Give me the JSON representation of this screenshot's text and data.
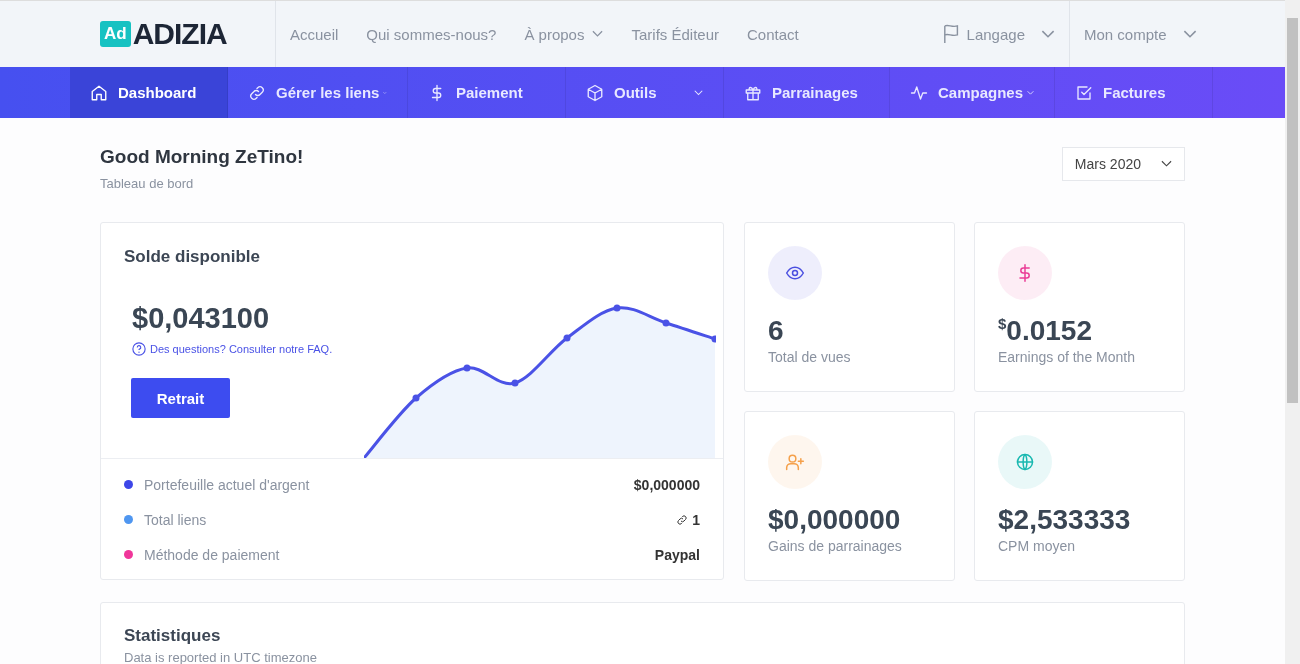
{
  "header": {
    "logo": {
      "badge": "Ad",
      "name": "ADIZIA"
    },
    "links": [
      {
        "label": "Accueil",
        "dropdown": false
      },
      {
        "label": "Qui sommes-nous?",
        "dropdown": false
      },
      {
        "label": "À propos",
        "dropdown": true
      },
      {
        "label": "Tarifs Éditeur",
        "dropdown": false
      },
      {
        "label": "Contact",
        "dropdown": false
      }
    ],
    "language": "Langage",
    "account": "Mon compte"
  },
  "nav": [
    {
      "label": "Dashboard",
      "selected": true,
      "dropdown": false
    },
    {
      "label": "Gérer les liens",
      "selected": false,
      "dropdown": true
    },
    {
      "label": "Paiement",
      "selected": false,
      "dropdown": false
    },
    {
      "label": "Outils",
      "selected": false,
      "dropdown": true
    },
    {
      "label": "Parrainages",
      "selected": false,
      "dropdown": false
    },
    {
      "label": "Campagnes",
      "selected": false,
      "dropdown": true
    },
    {
      "label": "Factures",
      "selected": false,
      "dropdown": false
    }
  ],
  "greeting": {
    "title": "Good Morning ZeTino!",
    "subtitle": "Tableau de bord"
  },
  "period": "Mars 2020",
  "balance": {
    "title": "Solde disponible",
    "amount": "$0,043100",
    "help": "Des questions? Consulter notre FAQ.",
    "button": "Retrait",
    "items": [
      {
        "label": "Portefeuille actuel d'argent",
        "value": "$0,000000",
        "color": "#3d46e8",
        "kind": "text"
      },
      {
        "label": "Total liens",
        "value": "1",
        "color": "#4f96f0",
        "kind": "links"
      },
      {
        "label": "Méthode de paiement",
        "value": "Paypal",
        "color": "#f0369a",
        "kind": "text"
      }
    ]
  },
  "stats": [
    {
      "value": "6",
      "label": "Total de vues",
      "color": "#4a4fe0"
    },
    {
      "currency": "$",
      "value": "0.0152",
      "label": "Earnings of the Month",
      "color": "#ea3c96"
    },
    {
      "value": "$0,000000",
      "label": "Gains de parrainages",
      "color": "#f5a04a"
    },
    {
      "value": "$2,533333",
      "label": "CPM moyen",
      "color": "#18b8b0"
    }
  ],
  "statistics": {
    "title": "Statistiques",
    "subtitle": "Data is reported in UTC timezone"
  }
}
